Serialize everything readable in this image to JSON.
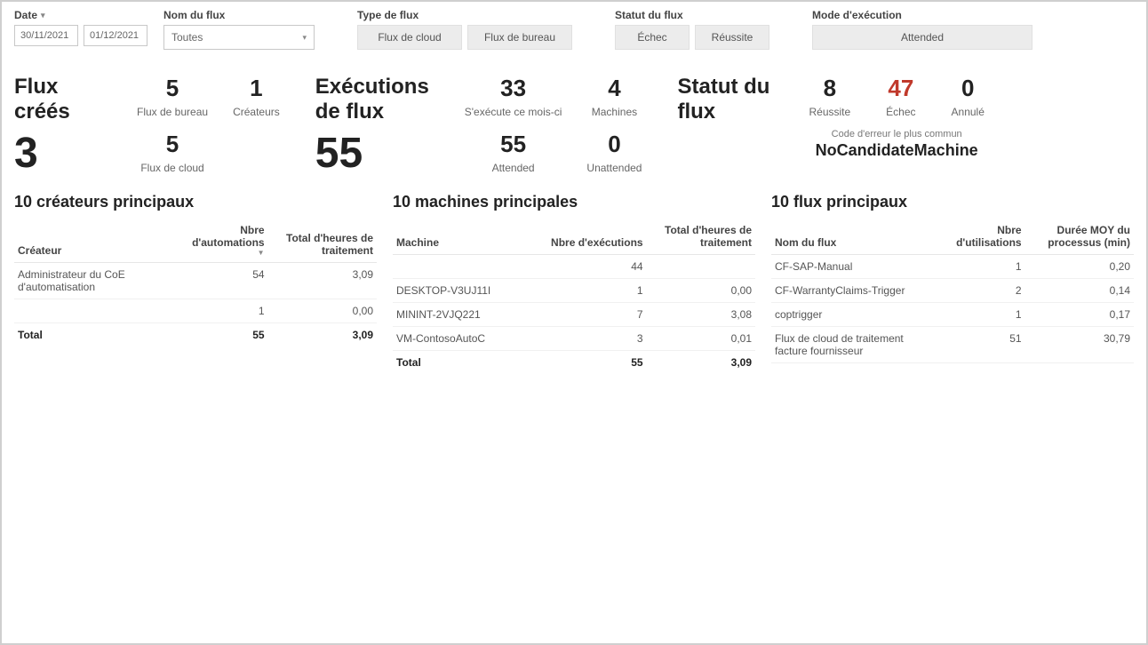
{
  "filters": {
    "date": {
      "label": "Date",
      "from": "30/11/2021",
      "to": "01/12/2021"
    },
    "flowName": {
      "label": "Nom du flux",
      "selected": "Toutes"
    },
    "flowType": {
      "label": "Type de flux",
      "options": [
        "Flux de cloud",
        "Flux de bureau"
      ]
    },
    "flowStatus": {
      "label": "Statut du flux",
      "options": [
        "Échec",
        "Réussite"
      ]
    },
    "execMode": {
      "label": "Mode d'exécution",
      "options": [
        "Attended"
      ]
    }
  },
  "kpi": {
    "created": {
      "title": "Flux créés",
      "total": "3",
      "desktop": {
        "value": "5",
        "label": "Flux de bureau"
      },
      "cloud": {
        "value": "5",
        "label": "Flux de cloud"
      },
      "creators": {
        "value": "1",
        "label": "Créateurs"
      }
    },
    "exec": {
      "title": "Exécutions de flux",
      "total": "55",
      "month": {
        "value": "33",
        "label": "S'exécute ce mois-ci"
      },
      "attended": {
        "value": "55",
        "label": "Attended"
      },
      "machines": {
        "value": "4",
        "label": "Machines"
      },
      "unattended": {
        "value": "0",
        "label": "Unattended"
      }
    },
    "status": {
      "title": "Statut du flux",
      "success": {
        "value": "8",
        "label": "Réussite"
      },
      "fail": {
        "value": "47",
        "label": "Échec"
      },
      "cancel": {
        "value": "0",
        "label": "Annulé"
      },
      "errLabel": "Code d'erreur le plus commun",
      "errCode": "NoCandidateMachine"
    }
  },
  "tables": {
    "creators": {
      "title": "10 créateurs principaux",
      "cols": [
        "Créateur",
        "Nbre d'automations",
        "Total d'heures de traitement"
      ],
      "rows": [
        {
          "c0": "Administrateur du CoE d'automatisation",
          "c1": "54",
          "c2": "3,09"
        },
        {
          "c0": "",
          "c1": "1",
          "c2": "0,00"
        }
      ],
      "total": {
        "label": "Total",
        "c1": "55",
        "c2": "3,09"
      }
    },
    "machines": {
      "title": "10 machines principales",
      "cols": [
        "Machine",
        "Nbre d'exécutions",
        "Total d'heures de traitement"
      ],
      "rows": [
        {
          "c0": "",
          "c1": "44",
          "c2": ""
        },
        {
          "c0": "DESKTOP-V3UJ11I",
          "c1": "1",
          "c2": "0,00"
        },
        {
          "c0": "MININT-2VJQ221",
          "c1": "7",
          "c2": "3,08"
        },
        {
          "c0": "VM-ContosoAutoC",
          "c1": "3",
          "c2": "0,01"
        }
      ],
      "total": {
        "label": "Total",
        "c1": "55",
        "c2": "3,09"
      }
    },
    "flows": {
      "title": "10 flux principaux",
      "cols": [
        "Nom du flux",
        "Nbre d'utilisations",
        "Durée MOY du processus (min)"
      ],
      "rows": [
        {
          "c0": "CF-SAP-Manual",
          "c1": "1",
          "c2": "0,20"
        },
        {
          "c0": "CF-WarrantyClaims-Trigger",
          "c1": "2",
          "c2": "0,14"
        },
        {
          "c0": "coptrigger",
          "c1": "1",
          "c2": "0,17"
        },
        {
          "c0": "Flux de cloud de traitement facture fournisseur",
          "c1": "51",
          "c2": "30,79"
        }
      ]
    }
  }
}
